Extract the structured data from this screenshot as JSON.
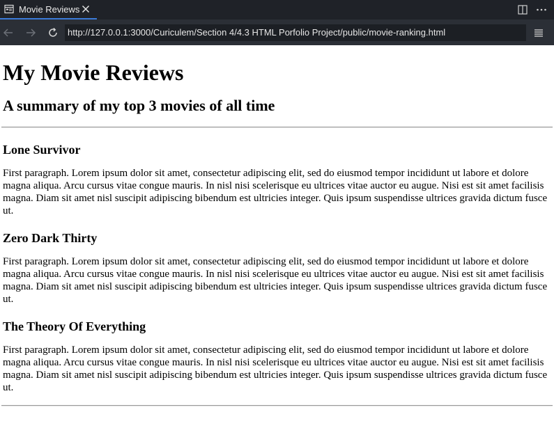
{
  "browser": {
    "tab": {
      "title": "Movie Reviews"
    },
    "url": "http://127.0.0.1:3000/Curiculem/Section 4/4.3 HTML Porfolio Project/public/movie-ranking.html"
  },
  "page": {
    "heading": "My Movie Reviews",
    "subheading": "A summary of my top 3 movies of all time",
    "movies": [
      {
        "title": "Lone Survivor",
        "review": "First paragraph. Lorem ipsum dolor sit amet, consectetur adipiscing elit, sed do eiusmod tempor incididunt ut labore et dolore magna aliqua. Arcu cursus vitae congue mauris. In nisl nisi scelerisque eu ultrices vitae auctor eu augue. Nisi est sit amet facilisis magna. Diam sit amet nisl suscipit adipiscing bibendum est ultricies integer. Quis ipsum suspendisse ultrices gravida dictum fusce ut."
      },
      {
        "title": "Zero Dark Thirty",
        "review": "First paragraph. Lorem ipsum dolor sit amet, consectetur adipiscing elit, sed do eiusmod tempor incididunt ut labore et dolore magna aliqua. Arcu cursus vitae congue mauris. In nisl nisi scelerisque eu ultrices vitae auctor eu augue. Nisi est sit amet facilisis magna. Diam sit amet nisl suscipit adipiscing bibendum est ultricies integer. Quis ipsum suspendisse ultrices gravida dictum fusce ut."
      },
      {
        "title": "The Theory Of Everything",
        "review": "First paragraph. Lorem ipsum dolor sit amet, consectetur adipiscing elit, sed do eiusmod tempor incididunt ut labore et dolore magna aliqua. Arcu cursus vitae congue mauris. In nisl nisi scelerisque eu ultrices vitae auctor eu augue. Nisi est sit amet facilisis magna. Diam sit amet nisl suscipit adipiscing bibendum est ultricies integer. Quis ipsum suspendisse ultrices gravida dictum fusce ut."
      }
    ]
  },
  "icons": {
    "tab": "browser-page-icon",
    "close": "close-icon",
    "split": "split-editor-icon",
    "more": "more-icon",
    "back": "arrow-left-icon",
    "forward": "arrow-right-icon",
    "reload": "reload-icon",
    "menu": "menu-icon"
  },
  "colors": {
    "tabbar": "#1f2228",
    "navbar": "#2b2f36",
    "urlbar": "#1c1f24",
    "tab_accent": "#3b7bd9"
  }
}
